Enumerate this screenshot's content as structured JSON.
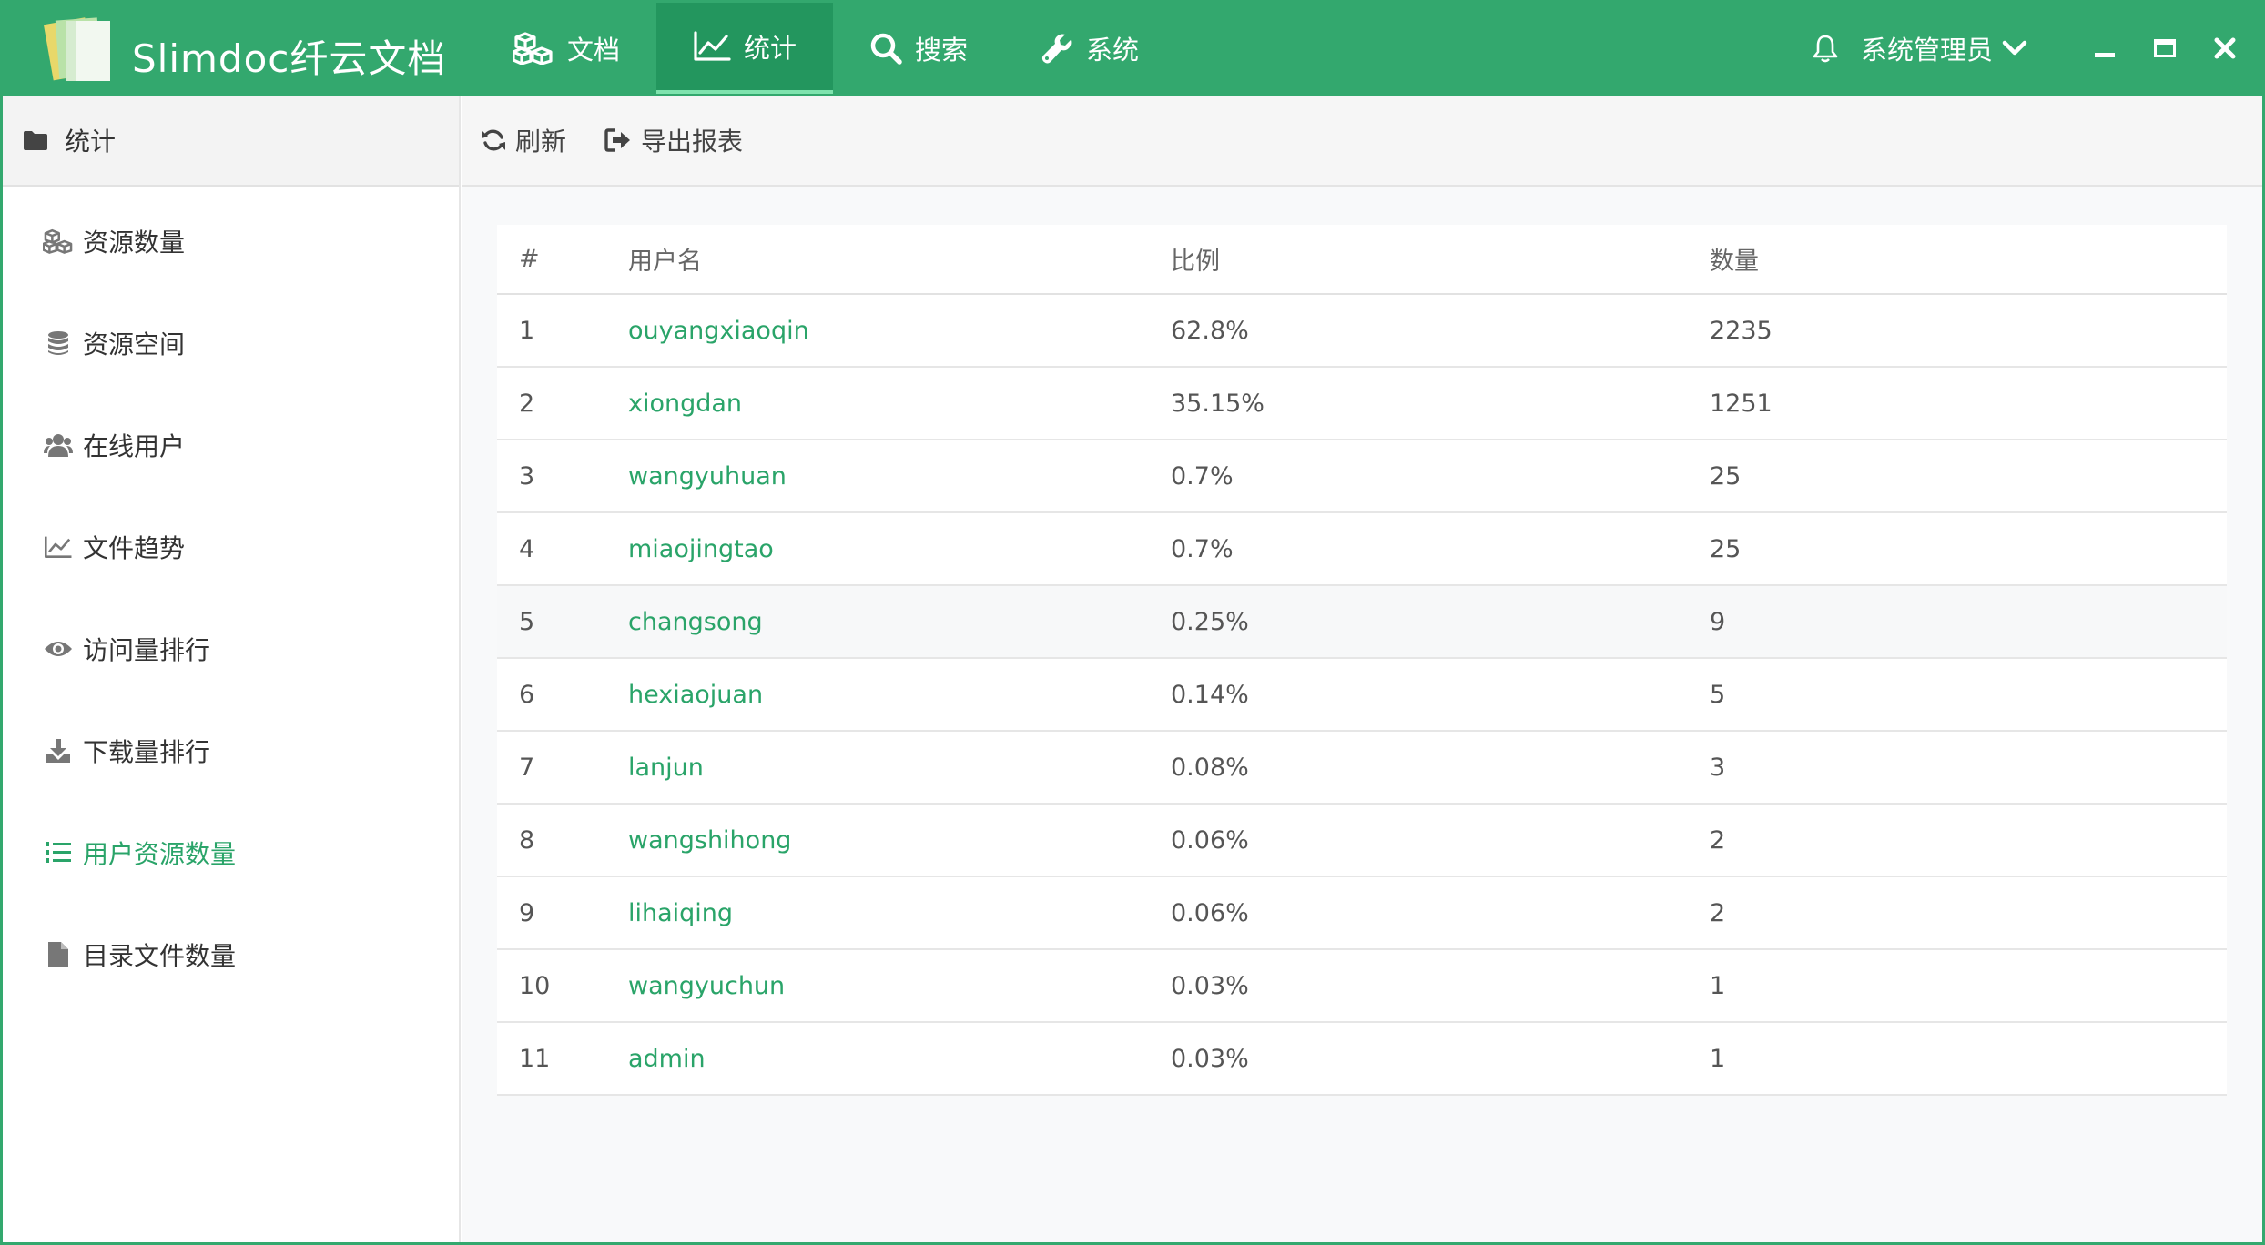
{
  "app": {
    "brand": "Slimdoc纤云文档",
    "accent_color": "#33a86e",
    "link_color": "#2aa469"
  },
  "nav": [
    {
      "label": "文档",
      "icon": "cubes-icon",
      "active": false
    },
    {
      "label": "统计",
      "icon": "line-chart-icon",
      "active": true
    },
    {
      "label": "搜索",
      "icon": "search-icon",
      "active": false
    },
    {
      "label": "系统",
      "icon": "wrench-icon",
      "active": false
    }
  ],
  "header": {
    "user_name": "系统管理员"
  },
  "sidebar": {
    "title": "统计",
    "items": [
      {
        "label": "资源数量",
        "icon": "cubes-icon",
        "active": false
      },
      {
        "label": "资源空间",
        "icon": "database-icon",
        "active": false
      },
      {
        "label": "在线用户",
        "icon": "users-icon",
        "active": false
      },
      {
        "label": "文件趋势",
        "icon": "line-chart-icon",
        "active": false
      },
      {
        "label": "访问量排行",
        "icon": "eye-icon",
        "active": false
      },
      {
        "label": "下载量排行",
        "icon": "download-icon",
        "active": false
      },
      {
        "label": "用户资源数量",
        "icon": "list-ol-icon",
        "active": true
      },
      {
        "label": "目录文件数量",
        "icon": "file-icon",
        "active": false
      }
    ]
  },
  "toolbar": {
    "refresh_label": "刷新",
    "export_label": "导出报表"
  },
  "table": {
    "headers": {
      "index": "#",
      "user": "用户名",
      "ratio": "比例",
      "count": "数量"
    },
    "rows": [
      {
        "index": "1",
        "user": "ouyangxiaoqin",
        "ratio": "62.8%",
        "count": "2235"
      },
      {
        "index": "2",
        "user": "xiongdan",
        "ratio": "35.15%",
        "count": "1251"
      },
      {
        "index": "3",
        "user": "wangyuhuan",
        "ratio": "0.7%",
        "count": "25"
      },
      {
        "index": "4",
        "user": "miaojingtao",
        "ratio": "0.7%",
        "count": "25"
      },
      {
        "index": "5",
        "user": "changsong",
        "ratio": "0.25%",
        "count": "9"
      },
      {
        "index": "6",
        "user": "hexiaojuan",
        "ratio": "0.14%",
        "count": "5"
      },
      {
        "index": "7",
        "user": "lanjun",
        "ratio": "0.08%",
        "count": "3"
      },
      {
        "index": "8",
        "user": "wangshihong",
        "ratio": "0.06%",
        "count": "2"
      },
      {
        "index": "9",
        "user": "lihaiqing",
        "ratio": "0.06%",
        "count": "2"
      },
      {
        "index": "10",
        "user": "wangyuchun",
        "ratio": "0.03%",
        "count": "1"
      },
      {
        "index": "11",
        "user": "admin",
        "ratio": "0.03%",
        "count": "1"
      }
    ]
  }
}
